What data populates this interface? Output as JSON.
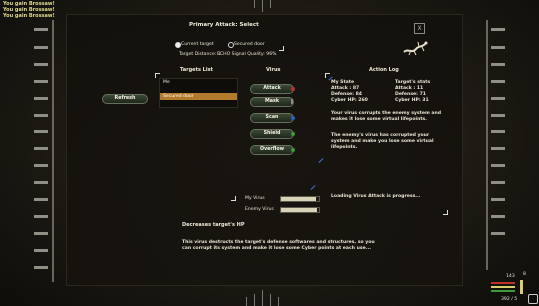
{
  "log": [
    "You gain Brossaw!",
    "You gain Brossaw!",
    "You gain Brossaw!"
  ],
  "window": {
    "title": "Primary Attack: Select",
    "close_label": "X"
  },
  "target": {
    "options": [
      {
        "label": "Current target",
        "selected": true
      },
      {
        "label": "Secured door",
        "selected": false
      }
    ],
    "distance": "Target Distance: 1",
    "signal": "ECHO Signal Quality: 96%"
  },
  "targets_list": {
    "header": "Targets List",
    "refresh_label": "Refresh",
    "items": [
      {
        "label": "Me",
        "selected": false
      },
      {
        "label": "Secured door",
        "selected": true
      }
    ]
  },
  "virus": {
    "header": "Virus",
    "buttons": [
      {
        "label": "Attack",
        "status": "red"
      },
      {
        "label": "Mask",
        "status": "none"
      },
      {
        "label": "Scan",
        "status": "blue"
      },
      {
        "label": "Shield",
        "status": "green"
      },
      {
        "label": "Overflow",
        "status": "green"
      }
    ]
  },
  "action_log": {
    "header": "Action Log",
    "my_state": {
      "title": "My State",
      "lines": [
        "Attack : 87",
        "Defense: 84",
        "Cyber HP: 260"
      ]
    },
    "target_stats": {
      "title": "Target's stats",
      "lines": [
        "Attack : 11",
        "Defense: 71",
        "Cyber HP: 31"
      ]
    },
    "messages": [
      "Your virus corrupts the enemy system and makes it lose some virtual lifepoints.",
      "The enemy's virus has corrupted your system and make you lose some virtual lifepoints."
    ],
    "loading": "Loading Virus Attack is progress..."
  },
  "progress": {
    "my_virus": {
      "label": "My Virus",
      "value": 0.92
    },
    "enemy_virus": {
      "label": "Enemy Virus",
      "value": 0.95
    }
  },
  "description": {
    "title": "Decreases target's HP",
    "body": "This virus destructs the target's defense softwares and structures, so you can corrupt its system and make it lose some Cyber points at each use..."
  },
  "hud": {
    "right_top": "143",
    "right_mid": "8",
    "right_bottom": "392 / 5"
  },
  "colors": {
    "red": "#c0302a",
    "blue": "#2c5fbf",
    "green": "#3c9a3a",
    "none": "#55524a",
    "accent": "#b27a2a",
    "text": "#e8e4d6"
  }
}
